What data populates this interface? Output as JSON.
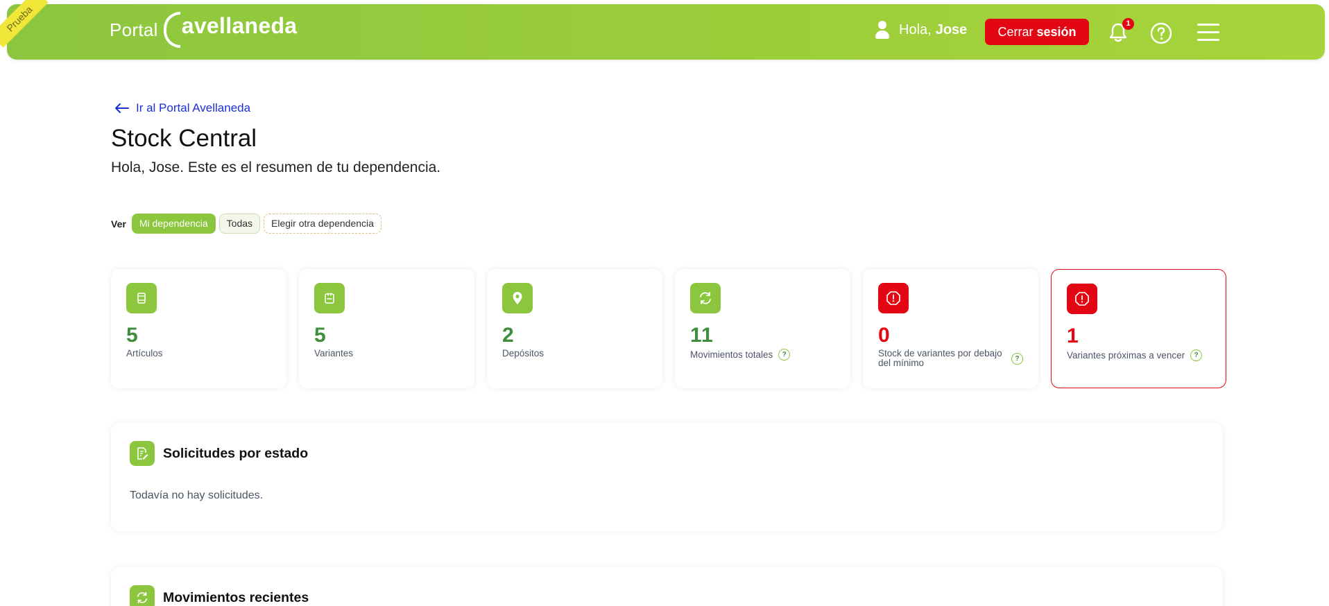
{
  "env_badge": "Prueba",
  "header": {
    "logo_portal": "Portal",
    "logo_brand": "avellaneda",
    "greeting": "Hola,",
    "user_name": "Jose",
    "logout_prefix": "Cerrar",
    "logout_bold": "sesión",
    "notification_count": "1",
    "brand_color": "#8cc63f",
    "alert_color": "#e30613"
  },
  "back_link": "Ir al Portal Avellaneda",
  "page": {
    "title": "Stock Central",
    "subtitle": "Hola, Jose. Este es el resumen de tu dependencia."
  },
  "filters": {
    "label": "Ver",
    "options": [
      "Mi dependencia",
      "Todas",
      "Elegir otra dependencia"
    ]
  },
  "stats": [
    {
      "icon": "article-icon",
      "value": "5",
      "label": "Artículos"
    },
    {
      "icon": "variant-icon",
      "value": "5",
      "label": "Variantes"
    },
    {
      "icon": "location-pin-icon",
      "value": "2",
      "label": "Depósitos"
    },
    {
      "icon": "refresh-icon",
      "value": "11",
      "label": "Movimientos totales"
    },
    {
      "icon": "warning-icon",
      "value": "0",
      "label": "Stock de variantes por debajo del mínimo"
    },
    {
      "icon": "warning-icon",
      "value": "1",
      "label": "Variantes próximas a vencer"
    }
  ],
  "help_mark": "?",
  "requests_panel": {
    "title": "Solicitudes por estado",
    "empty_text": "Todavía no hay solicitudes."
  },
  "movements_panel": {
    "title": "Movimientos recientes"
  }
}
